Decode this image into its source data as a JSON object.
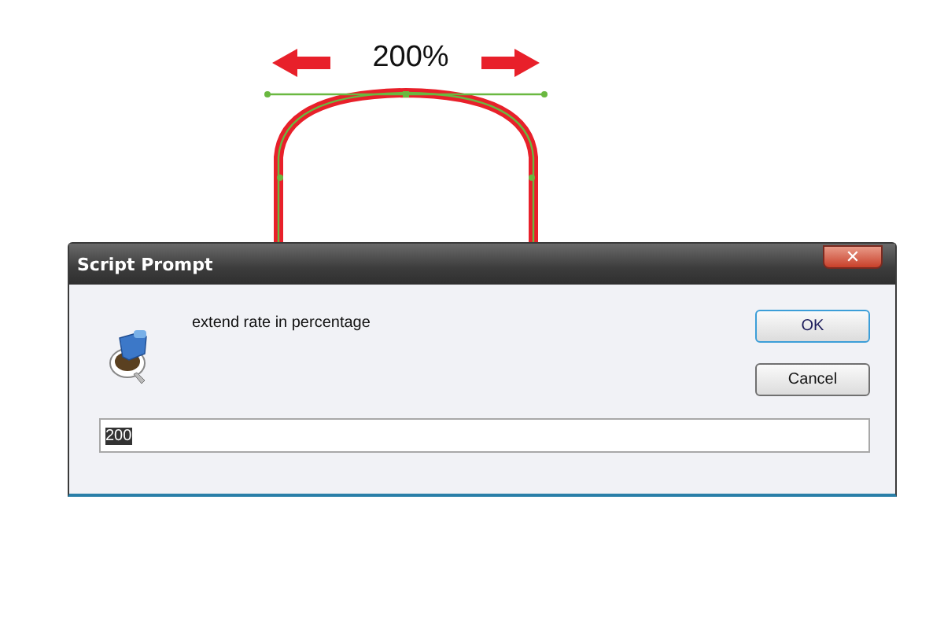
{
  "canvas": {
    "measure_label": "200%"
  },
  "dialog": {
    "title": "Script Prompt",
    "close_symbol": "✕",
    "message": "extend rate in percentage",
    "buttons": [
      {
        "label": "OK",
        "default": true
      },
      {
        "label": "Cancel",
        "default": false
      }
    ],
    "input": {
      "value": "200",
      "text_selected": true
    }
  }
}
